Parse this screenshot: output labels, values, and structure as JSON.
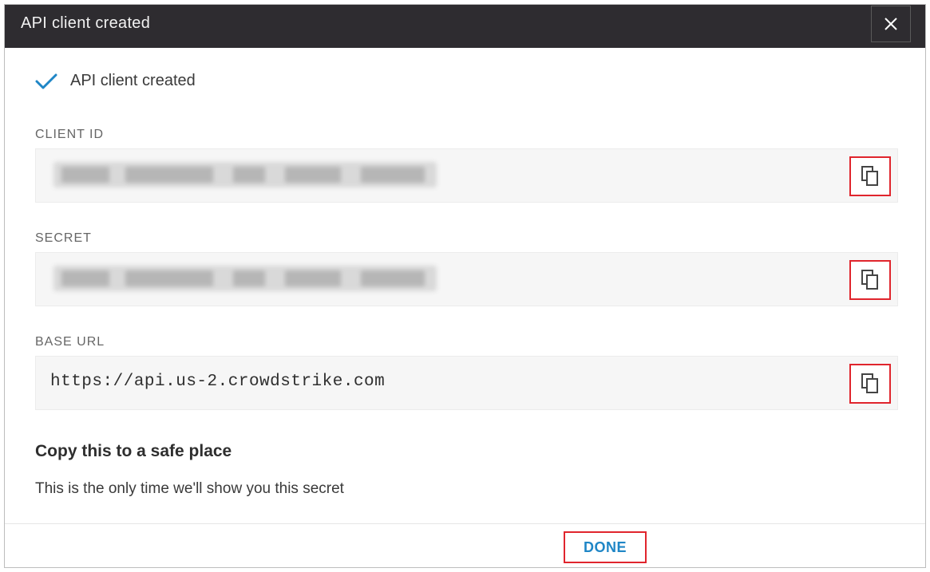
{
  "dialog": {
    "title": "API client created",
    "close_icon": "close-icon"
  },
  "status": {
    "icon": "checkmark-icon",
    "text": "API client created",
    "accent_color": "#1f86c6"
  },
  "fields": {
    "client_id": {
      "label": "CLIENT ID",
      "value_redacted": true,
      "copy_icon": "copy-icon"
    },
    "secret": {
      "label": "SECRET",
      "value_redacted": true,
      "copy_icon": "copy-icon"
    },
    "base_url": {
      "label": "BASE URL",
      "value": "https://api.us-2.crowdstrike.com",
      "copy_icon": "copy-icon"
    }
  },
  "notice": {
    "title": "Copy this to a safe place",
    "text": "This is the only time we'll show you this secret"
  },
  "footer": {
    "done_label": "DONE"
  },
  "colors": {
    "titlebar": "#2e2c30",
    "highlight": "#e0252d",
    "link": "#1f86c6"
  }
}
